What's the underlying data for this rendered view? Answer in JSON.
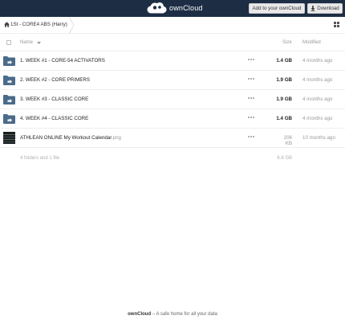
{
  "header": {
    "app_name": "ownCloud",
    "add_button_label": "Add to your ownCloud",
    "download_button_label": "Download"
  },
  "breadcrumb": {
    "label": "1St - CORE4 ABS (Harry)"
  },
  "columns": {
    "name": "Name",
    "size": "Size",
    "modified": "Modified"
  },
  "files": [
    {
      "name": "1. WEEK #1 - CORE-54 ACTIVATORS",
      "ext": "",
      "size": "1.4 GB",
      "modified": "4 months ago",
      "type": "folder-icon"
    },
    {
      "name": "2. WEEK #2 - CORE PRIMERS",
      "ext": "",
      "size": "1.9 GB",
      "modified": "4 months ago",
      "type": "folder-icon"
    },
    {
      "name": "3. WEEK #3 - CLASSIC CORE",
      "ext": "",
      "size": "1.9 GB",
      "modified": "4 months ago",
      "type": "folder-icon"
    },
    {
      "name": "4. WEEK #4 - CLASSIC CORE",
      "ext": "",
      "size": "1.4 GB",
      "modified": "4 months ago",
      "type": "folder-icon"
    },
    {
      "name": "ATHLEAN ONLINE My Workout Calendar",
      "ext": ".png",
      "size": "206 KB",
      "modified": "10 months ago",
      "type": "image-thumbnail"
    }
  ],
  "summary": {
    "count_text": "4 folders and 1 file",
    "total_size": "6.6 GB"
  },
  "footer": {
    "brand": "ownCloud",
    "tagline": " – A safe home for all your data"
  },
  "colors": {
    "header_bg": "#1d2d44",
    "folder_icon": "#4a6b8a"
  }
}
